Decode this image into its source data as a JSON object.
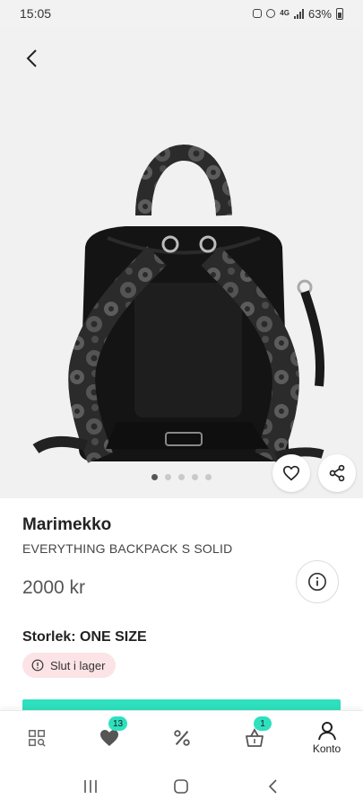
{
  "status_bar": {
    "time": "15:05",
    "network": "4G",
    "battery": "63%"
  },
  "product": {
    "brand": "Marimekko",
    "name": "EVERYTHING BACKPACK S SOLID",
    "price": "2000 kr",
    "size_label": "Storlek: ONE SIZE",
    "stock_status": "Slut i lager",
    "image_count": 5,
    "active_image": 1
  },
  "icons": {
    "back": "chevron-left-icon",
    "favorite": "heart-outline-icon",
    "share": "share-icon",
    "info": "info-icon",
    "stock": "alert-circle-icon"
  },
  "colors": {
    "accent": "#2ee0be",
    "stock_badge_bg": "#fbe3e6",
    "image_bg": "#f1f1f1"
  },
  "bottom_nav": {
    "items": [
      {
        "id": "categories",
        "icon": "grid-search-icon",
        "label": ""
      },
      {
        "id": "favorites",
        "icon": "heart-icon",
        "label": "",
        "badge": "13"
      },
      {
        "id": "offers",
        "icon": "percent-icon",
        "label": ""
      },
      {
        "id": "cart",
        "icon": "basket-icon",
        "label": "",
        "badge": "1"
      },
      {
        "id": "account",
        "icon": "person-icon",
        "label": "Konto"
      }
    ]
  }
}
